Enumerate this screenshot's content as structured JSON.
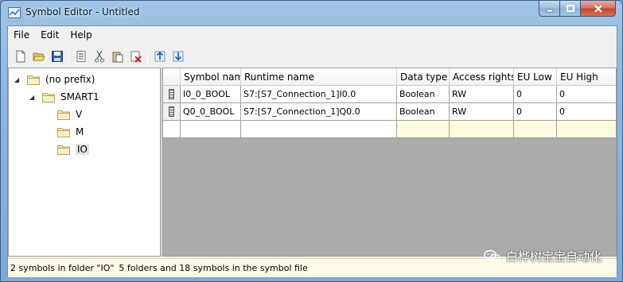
{
  "window": {
    "title": "Symbol Editor - Untitled",
    "caption_buttons": [
      "minimize-icon",
      "maximize-icon",
      "close-icon"
    ]
  },
  "menu": [
    "File",
    "Edit",
    "Help"
  ],
  "toolbar": {
    "buttons": [
      "new-icon",
      "open-icon",
      "save-icon",
      "properties-icon",
      "cut-icon",
      "paste-icon",
      "delete-icon",
      "import-icon",
      "export-icon"
    ]
  },
  "tree": {
    "nodes": [
      {
        "label": "(no prefix)",
        "expanded": true,
        "level": 0
      },
      {
        "label": "SMART1",
        "expanded": true,
        "level": 1
      },
      {
        "label": "V",
        "level": 2
      },
      {
        "label": "M",
        "level": 2
      },
      {
        "label": "IO",
        "level": 2,
        "selected": true
      }
    ]
  },
  "grid": {
    "headers": [
      "Symbol nam",
      "Runtime name",
      "Data type",
      "Access rights",
      "EU Low",
      "EU High"
    ],
    "rows": [
      {
        "symbol": "I0_0_BOOL",
        "runtime": "S7:[S7_Connection_1]I0.0",
        "type": "Boolean",
        "access": "RW",
        "eu_low": "0",
        "eu_high": "0"
      },
      {
        "symbol": "Q0_0_BOOL",
        "runtime": "S7:[S7_Connection_1]Q0.0",
        "type": "Boolean",
        "access": "RW",
        "eu_low": "0",
        "eu_high": "0"
      }
    ]
  },
  "status": {
    "left": "2 symbols in folder \"IO\"",
    "right": "5 folders and 18 symbols in the symbol file"
  },
  "watermark": {
    "text": "白桦树宝宝自动化",
    "icon": "wechat-icon"
  },
  "colors": {
    "status_bg": "#fff9e8",
    "new_row_tint": "#fffbdc",
    "close_button": "#c2442a"
  }
}
